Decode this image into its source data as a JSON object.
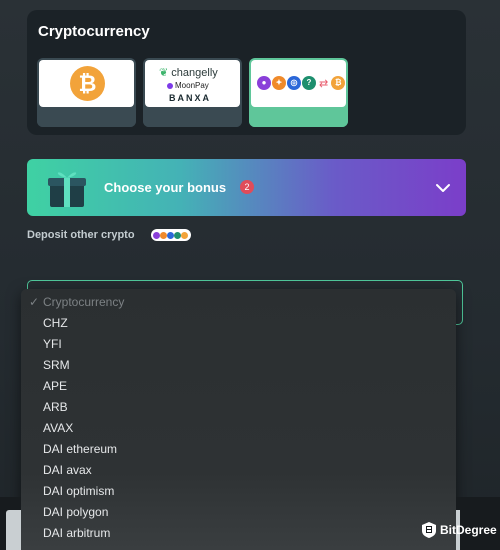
{
  "crypto": {
    "title": "Cryptocurrency",
    "methods": [
      {
        "name": "Bitcoin",
        "symbol": "₿"
      },
      {
        "name": "Changelly / MoonPay / BANXA",
        "changelly": "changelly",
        "moonpay": "MoonPay",
        "banxa": "BANXA"
      },
      {
        "name": "Other coins to Bitcoin"
      }
    ]
  },
  "bonus": {
    "label": "Choose your bonus",
    "count": "2"
  },
  "deposit": {
    "label": "Deposit other crypto"
  },
  "dropdown": {
    "selected": "Cryptocurrency",
    "options": [
      "CHZ",
      "YFI",
      "SRM",
      "APE",
      "ARB",
      "AVAX",
      "DAI ethereum",
      "DAI avax",
      "DAI optimism",
      "DAI polygon",
      "DAI arbitrum"
    ]
  },
  "watermark": {
    "text": "BitDegree"
  },
  "colors": {
    "accent": "#5fc69a",
    "bitcoin": "#f2a33a",
    "badge": "#e04c5a"
  }
}
